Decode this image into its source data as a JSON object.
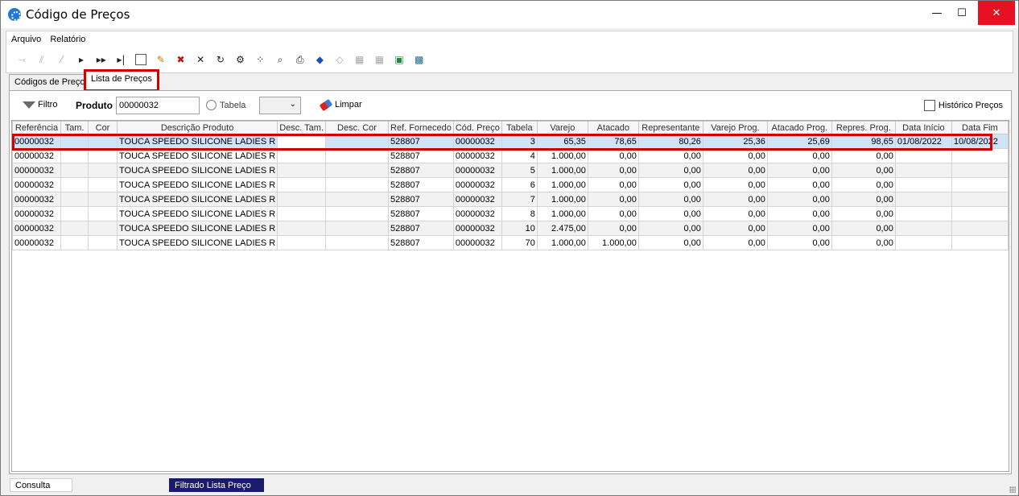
{
  "window": {
    "title": "Código de Preços"
  },
  "menu": [
    "Arquivo",
    "Relatório"
  ],
  "toolbar": {
    "icons": [
      "first-disabled-icon",
      "prev-page-disabled-icon",
      "prev-disabled-icon",
      "next-icon",
      "next-page-icon",
      "last-icon",
      "new-document-icon",
      "edit-icon",
      "delete-icon",
      "cancel-icon",
      "refresh-icon",
      "properties-icon",
      "wand-icon",
      "preview-icon",
      "print-icon",
      "tag-icon",
      "goto-icon",
      "filter-tb-icon",
      "settings-tb-icon",
      "export-excel-icon",
      "export-icon"
    ]
  },
  "tabs": [
    {
      "label": "Códigos de Preço",
      "active": false
    },
    {
      "label": "Lista de Preços",
      "active": true
    }
  ],
  "filter": {
    "filtro_label": "Filtro",
    "produto_label": "Produto",
    "produto_value": "00000032",
    "tabela_label": "Tabela",
    "tabela_value": "",
    "limpar_label": "Limpar",
    "historico_label": "Histórico Preços"
  },
  "grid": {
    "columns": [
      "Referência",
      "Tam.",
      "Cor",
      "Descrição Produto",
      "Desc. Tam.",
      "Desc. Cor",
      "Ref. Fornecedo",
      "Cód. Preço",
      "Tabela",
      "Varejo",
      "Atacado",
      "Representante",
      "Varejo Prog.",
      "Atacado Prog.",
      "Repres. Prog.",
      "Data Início",
      "Data Fim"
    ],
    "rows": [
      [
        "00000032",
        "",
        "",
        "TOUCA SPEEDO SILICONE LADIES R",
        "",
        "",
        "528807",
        "00000032",
        "3",
        "65,35",
        "78,65",
        "80,26",
        "25,36",
        "25,69",
        "98,65",
        "01/08/2022",
        "10/08/2022"
      ],
      [
        "00000032",
        "",
        "",
        "TOUCA SPEEDO SILICONE LADIES R",
        "",
        "",
        "528807",
        "00000032",
        "4",
        "1.000,00",
        "0,00",
        "0,00",
        "0,00",
        "0,00",
        "0,00",
        "",
        ""
      ],
      [
        "00000032",
        "",
        "",
        "TOUCA SPEEDO SILICONE LADIES R",
        "",
        "",
        "528807",
        "00000032",
        "5",
        "1.000,00",
        "0,00",
        "0,00",
        "0,00",
        "0,00",
        "0,00",
        "",
        ""
      ],
      [
        "00000032",
        "",
        "",
        "TOUCA SPEEDO SILICONE LADIES R",
        "",
        "",
        "528807",
        "00000032",
        "6",
        "1.000,00",
        "0,00",
        "0,00",
        "0,00",
        "0,00",
        "0,00",
        "",
        ""
      ],
      [
        "00000032",
        "",
        "",
        "TOUCA SPEEDO SILICONE LADIES R",
        "",
        "",
        "528807",
        "00000032",
        "7",
        "1.000,00",
        "0,00",
        "0,00",
        "0,00",
        "0,00",
        "0,00",
        "",
        ""
      ],
      [
        "00000032",
        "",
        "",
        "TOUCA SPEEDO SILICONE LADIES R",
        "",
        "",
        "528807",
        "00000032",
        "8",
        "1.000,00",
        "0,00",
        "0,00",
        "0,00",
        "0,00",
        "0,00",
        "",
        ""
      ],
      [
        "00000032",
        "",
        "",
        "TOUCA SPEEDO SILICONE LADIES R",
        "",
        "",
        "528807",
        "00000032",
        "10",
        "2.475,00",
        "0,00",
        "0,00",
        "0,00",
        "0,00",
        "0,00",
        "",
        ""
      ],
      [
        "00000032",
        "",
        "",
        "TOUCA SPEEDO SILICONE LADIES R",
        "",
        "",
        "528807",
        "00000032",
        "70",
        "1.000,00",
        "1.000,00",
        "0,00",
        "0,00",
        "0,00",
        "0,00",
        "",
        ""
      ]
    ],
    "selected_row": 0
  },
  "status": {
    "left": "Consulta",
    "right": "Filtrado Lista Preço"
  },
  "colors": {
    "selection": "#cfe4f7",
    "highlight": "#d40000",
    "status_dark": "#1a1a6e",
    "close": "#e81123"
  }
}
